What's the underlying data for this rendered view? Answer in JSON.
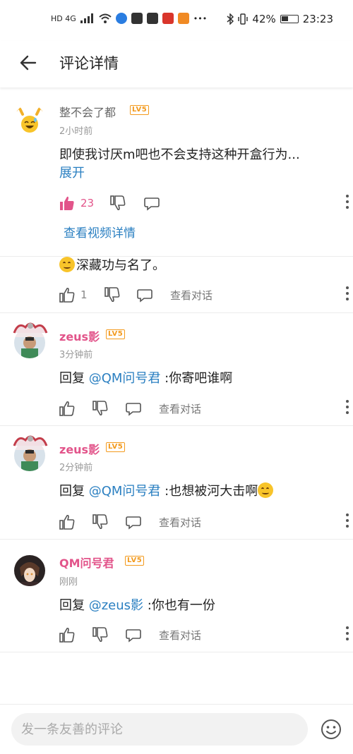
{
  "status_bar": {
    "left_text": "HD 4G",
    "battery": "42%",
    "time": "23:23"
  },
  "header": {
    "title": "评论详情"
  },
  "comments": [
    {
      "username": "整不会了都",
      "level": "LV5",
      "time": "2小时前",
      "text": "即使我讨厌m吧也不会支持这种开盒行为...",
      "expand": "展开",
      "likes": "23",
      "video_link": "查看视频详情"
    },
    {
      "text": "深藏功与名了。",
      "likes": "1",
      "view_convo": "查看对话"
    },
    {
      "username": "zeus影",
      "level": "LV5",
      "time": "3分钟前",
      "reply_prefix": "回复 ",
      "mention": "@QM问号君",
      "text": " :你寄吧谁啊",
      "view_convo": "查看对话"
    },
    {
      "username": "zeus影",
      "level": "LV5",
      "time": "2分钟前",
      "reply_prefix": "回复 ",
      "mention": "@QM问号君",
      "text": " :也想被河大击啊",
      "view_convo": "查看对话"
    },
    {
      "username": "QM问号君",
      "level": "LV5",
      "time": "刚刚",
      "reply_prefix": "回复 ",
      "mention": "@zeus影",
      "text": " :你也有一份",
      "view_convo": "查看对话"
    }
  ],
  "composer": {
    "placeholder": "发一条友善的评论"
  },
  "colors": {
    "accent_pink": "#e2548a",
    "link_blue": "#2a7fc1",
    "level_orange": "#f39a1d"
  }
}
